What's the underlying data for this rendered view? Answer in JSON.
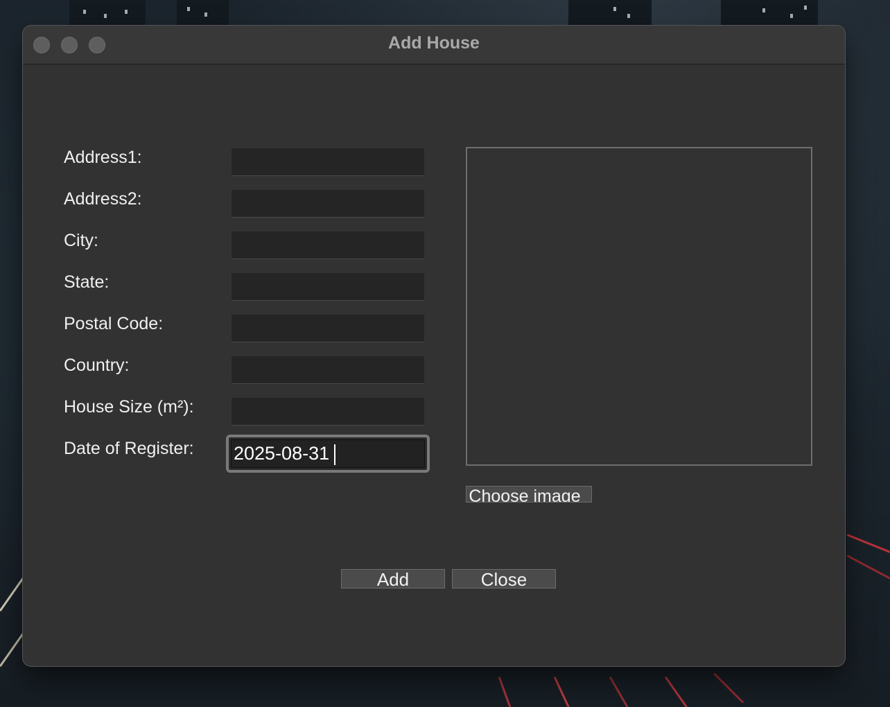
{
  "window": {
    "title": "Add House"
  },
  "form": {
    "fields": [
      {
        "label": "Address1:",
        "value": ""
      },
      {
        "label": "Address2:",
        "value": ""
      },
      {
        "label": "City:",
        "value": ""
      },
      {
        "label": "State:",
        "value": ""
      },
      {
        "label": "Postal Code:",
        "value": ""
      },
      {
        "label": "Country:",
        "value": ""
      },
      {
        "label": "House Size (m²):",
        "value": ""
      },
      {
        "label": "Date of Register:",
        "value": "2025-08-31"
      }
    ]
  },
  "image_panel": {
    "choose_label": "Choose image"
  },
  "actions": {
    "add_label": "Add",
    "close_label": "Close"
  },
  "colors": {
    "window_bg": "#323232",
    "titlebar_bg": "#383838",
    "field_bg": "#252525",
    "button_bg": "#4b4b4b",
    "text": "#f0f0f0"
  }
}
